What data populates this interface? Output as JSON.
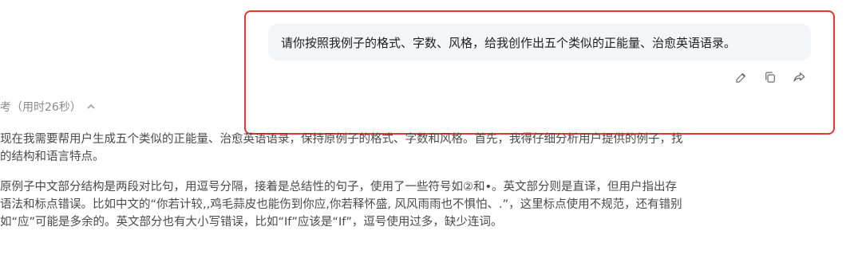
{
  "user_message": {
    "text": "请你按照我例子的格式、字数、风格，给我创作出五个类似的正能量、治愈英语语录。"
  },
  "actions": {
    "edit_icon": "pencil-icon",
    "copy_icon": "copy-icon",
    "share_icon": "share-icon"
  },
  "thinking": {
    "header": "考（用时26秒）",
    "paragraphs": [
      {
        "lines": [
          "现在我需要帮用户生成五个类似的正能量、治愈英语语录，保持原例子的格式、字数和风格。首先，我得仔细分析用户提供的例子，找",
          "的结构和语言特点。"
        ]
      },
      {
        "lines": [
          "原例子中文部分结构是两段对比句，用逗号分隔，接着是总结性的句子，使用了一些符号如②和•。英文部分则是直译，但用户指出存",
          "语法和标点错误。比如中文的“你若计较,,鸡毛蒜皮也能伤到你应,你若释怀盛, 风风雨雨也不惧怕、.”，这里标点使用不规范，还有错别",
          "如“应”可能是多余的。英文部分也有大小写错误，比如“If”应该是“If”，逗号使用过多，缺少连词。"
        ]
      }
    ]
  },
  "colors": {
    "highlight_border": "#e8372c",
    "bubble_bg": "#f4f5f7",
    "muted_text": "#8a8a8a"
  }
}
